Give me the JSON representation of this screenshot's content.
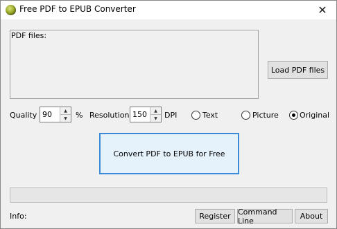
{
  "window": {
    "title": "Free PDF to EPUB Converter",
    "close_symbol": "✕",
    "app_icon": "app-logo-icon"
  },
  "files": {
    "label": "PDF files:",
    "load_button": "Load PDF files"
  },
  "settings": {
    "quality_label": "Quality",
    "quality_value": "90",
    "quality_unit": "%",
    "resolution_label": "Resolution",
    "resolution_value": "150",
    "resolution_unit": "DPI",
    "modes": [
      {
        "label": "Text",
        "selected": false
      },
      {
        "label": "Picture",
        "selected": false
      },
      {
        "label": "Original",
        "selected": true
      }
    ]
  },
  "actions": {
    "convert_label": "Convert PDF to EPUB for Free"
  },
  "progress": {
    "fraction": 0
  },
  "footer": {
    "info_label": "Info:",
    "register": "Register",
    "command_line": "Command Line",
    "about": "About"
  },
  "colors": {
    "accent_border": "#3a8ad6",
    "accent_fill": "#e5f1fb"
  }
}
